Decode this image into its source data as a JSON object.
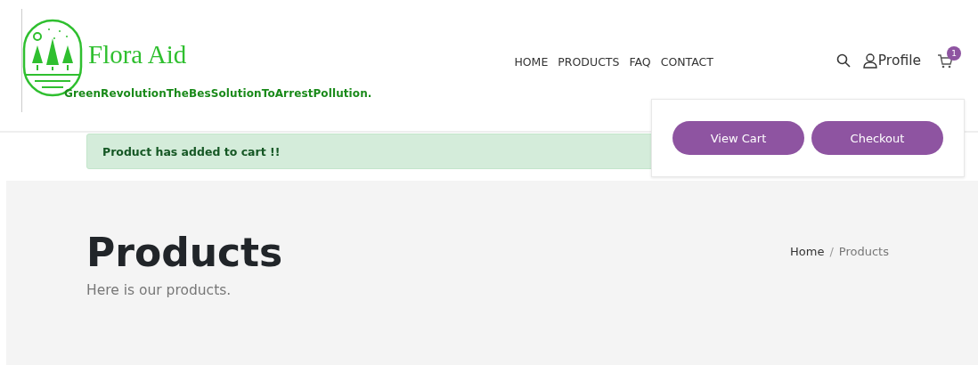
{
  "brand": {
    "name": "Flora Aid",
    "tagline": "GreenRevolutionTheBesSolutionToArrestPollution."
  },
  "nav": [
    {
      "label": "HOME"
    },
    {
      "label": "PRODUCTS"
    },
    {
      "label": "FAQ"
    },
    {
      "label": "CONTACT"
    }
  ],
  "profile": {
    "label": "Profile"
  },
  "cart": {
    "count": "1"
  },
  "cart_dropdown": {
    "buttons": [
      "View Cart",
      "Checkout"
    ]
  },
  "alert": {
    "message": "Product has added to cart !!"
  },
  "hero": {
    "title": "Products",
    "subtitle": "Here is our products.",
    "breadcrumb_separator": "/",
    "breadcrumb": [
      {
        "label": "Home",
        "selected": false
      },
      {
        "label": "Products",
        "selected": true
      }
    ]
  }
}
